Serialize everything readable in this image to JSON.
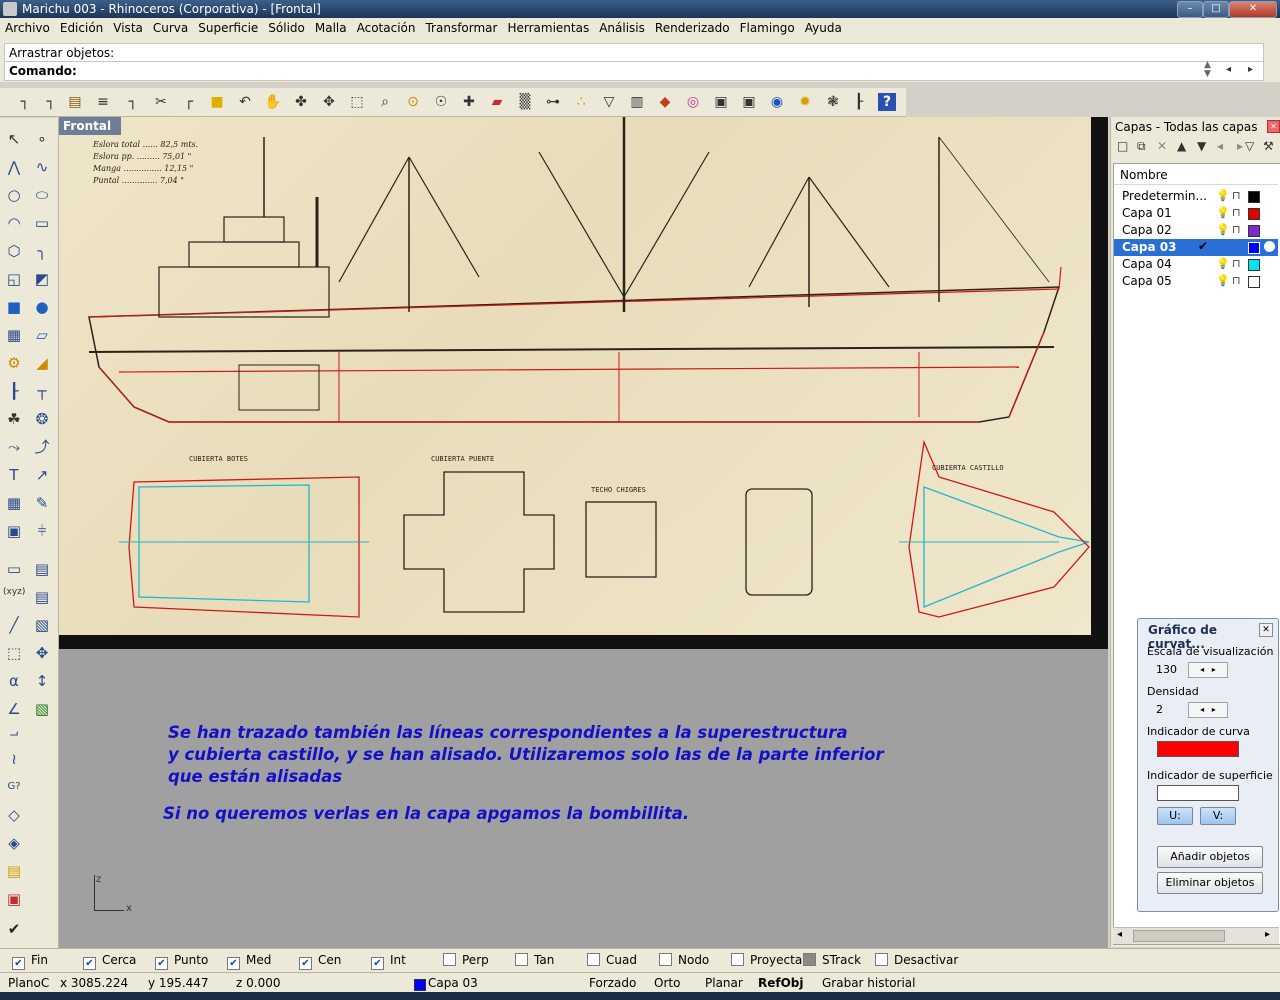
{
  "window": {
    "title": "Marichu 003 - Rhinoceros (Corporativa) - [Frontal]"
  },
  "menu": [
    "Archivo",
    "Edición",
    "Vista",
    "Curva",
    "Superficie",
    "Sólido",
    "Malla",
    "Acotación",
    "Transformar",
    "Herramientas",
    "Análisis",
    "Renderizado",
    "Flamingo",
    "Ayuda"
  ],
  "command": {
    "history": "Arrastrar objetos:",
    "prompt": "Comando:"
  },
  "viewport": {
    "label": "Frontal",
    "notes": [
      "Se han trazado también las líneas correspondientes a la superestructura",
      "y cubierta castillo, y se han alisado. Utilizaremos solo las de la parte inferior",
      "que están alisadas",
      "Si no queremos verlas en la capa apgamos la bombillita."
    ],
    "axis": {
      "z": "z",
      "x": "x"
    },
    "blueprint_labels": {
      "spec1": "Eslora total ...... 82,5 mts.",
      "spec2": "Eslora pp. ......... 75,01 \"",
      "spec3": "Manga ............... 12,15 \"",
      "spec4": "Puntal .............. 7,04 \"",
      "deck1": "CUBIERTA BOTES",
      "deck2": "CUBIERTA PUENTE",
      "deck3": "TECHO CHIGRES",
      "deck4": "CUBIERTA CASTILLO"
    }
  },
  "layers": {
    "header": "Capas - Todas las capas",
    "column": "Nombre",
    "rows": [
      {
        "name": "Predetermin...",
        "color": "#000000",
        "current": false
      },
      {
        "name": "Capa 01",
        "color": "#e00000",
        "current": false
      },
      {
        "name": "Capa 02",
        "color": "#7a2bc8",
        "current": false
      },
      {
        "name": "Capa 03",
        "color": "#0000ff",
        "current": true
      },
      {
        "name": "Capa 04",
        "color": "#00e5f0",
        "current": false
      },
      {
        "name": "Capa 05",
        "color": "#ffffff",
        "current": false
      }
    ]
  },
  "curvature": {
    "title": "Gráfico de curvat...",
    "scale_label": "Escala de visualización",
    "scale_value": "130",
    "density_label": "Densidad",
    "density_value": "2",
    "curve_hair_label": "Indicador de curva",
    "curve_hair_color": "#ff0000",
    "surface_hair_label": "Indicador de superficie",
    "u_label": "U:",
    "v_label": "V:",
    "add_button": "Añadir objetos",
    "remove_button": "Eliminar objetos"
  },
  "osnap": [
    {
      "label": "Fin",
      "checked": true
    },
    {
      "label": "Cerca",
      "checked": true
    },
    {
      "label": "Punto",
      "checked": true
    },
    {
      "label": "Med",
      "checked": true
    },
    {
      "label": "Cen",
      "checked": true
    },
    {
      "label": "Int",
      "checked": true
    },
    {
      "label": "Perp",
      "checked": false
    },
    {
      "label": "Tan",
      "checked": false
    },
    {
      "label": "Cuad",
      "checked": false
    },
    {
      "label": "Nodo",
      "checked": false
    },
    {
      "label": "Proyectar",
      "checked": false
    },
    {
      "label": "STrack",
      "checked": false
    },
    {
      "label": "Desactivar",
      "checked": false
    }
  ],
  "status": {
    "cplane": "PlanoC",
    "x": "x 3085.224",
    "y": "y 195.447",
    "z": "z 0.000",
    "layer": "Capa 03",
    "layer_color": "#0000ff",
    "toggles": [
      "Forzado",
      "Orto",
      "Planar",
      "RefObj",
      "Grabar historial"
    ]
  }
}
